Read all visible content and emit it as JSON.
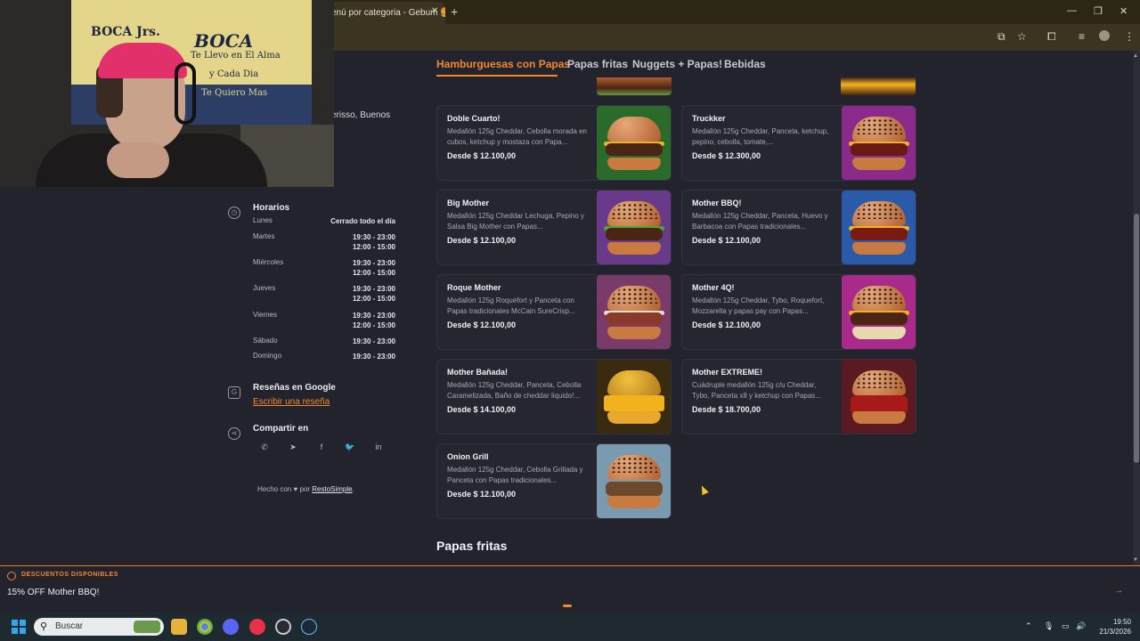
{
  "browser": {
    "tab_title": "enú por categoria - Gebum 🍔",
    "tab_close": "✕",
    "new_tab": "+",
    "window_controls": [
      "—",
      "❐",
      "✕"
    ]
  },
  "sidebar": {
    "address_fragment": "erisso, Buenos",
    "hours_heading": "Horarios",
    "hours": [
      {
        "day": "Lunes",
        "value": "Cerrado todo el día"
      },
      {
        "day": "Martes",
        "value": "19:30 - 23:00\n12:00 - 15:00"
      },
      {
        "day": "Miércoles",
        "value": "19:30 - 23:00\n12:00 - 15:00"
      },
      {
        "day": "Jueves",
        "value": "19:30 - 23:00\n12:00 - 15:00"
      },
      {
        "day": "Viernes",
        "value": "19:30 - 23:00\n12:00 - 15:00"
      },
      {
        "day": "Sábado",
        "value": "19:30 - 23:00"
      },
      {
        "day": "Domingo",
        "value": "19:30 - 23:00"
      }
    ],
    "reviews_heading": "Reseñas en Google",
    "reviews_link": "Escribir una reseña",
    "share_heading": "Compartir en",
    "share_icons": [
      "whatsapp-icon",
      "telegram-icon",
      "facebook-icon",
      "twitter-icon",
      "linkedin-icon"
    ],
    "footer_prefix": "Hecho con ♥ por",
    "footer_link": "RestoSimple",
    "footer_suffix": "."
  },
  "categories": [
    "Hamburguesas con Papas",
    "Papas fritas",
    "Nuggets + Papas!",
    "Bebidas"
  ],
  "products": [
    {
      "title": "Doble Cuarto!",
      "desc": "Medallón 125g Cheddar, Cebolla morada en cubos, ketchup y mostaza con Papa...",
      "price": "Desde $ 12.100,00"
    },
    {
      "title": "Truckker",
      "desc": "Medallón 125g Cheddar, Panceta, ketchup, pepino, cebolla, tomate,...",
      "price": "Desde $ 12.300,00"
    },
    {
      "title": "Big Mother",
      "desc": "Medallón 125g Cheddar Lechuga, Pepino y Salsa Big Mother con Papas...",
      "price": "Desde $ 12.100,00"
    },
    {
      "title": "Mother BBQ!",
      "desc": "Medallón 125g Cheddar, Panceta, Huevo y Barbacoa con Papas tradicionales...",
      "price": "Desde $ 12.100,00"
    },
    {
      "title": "Roque Mother",
      "desc": "Medallón 125g Roquefort y Panceta con Papas tradicionales McCain SureCrisp...",
      "price": "Desde $ 12.100,00"
    },
    {
      "title": "Mother 4Q!",
      "desc": "Medallón 125g Cheddar, Tybo, Roquefort, Mozzarella y papas pay con Papas...",
      "price": "Desde $ 12.100,00"
    },
    {
      "title": "Mother Bañada!",
      "desc": "Medallón 125g Cheddar, Panceta, Cebolla Caramelizada, Baño de cheddar liquido!...",
      "price": "Desde $ 14.100,00"
    },
    {
      "title": "Mother EXTREME!",
      "desc": "Cuádruple medallón 125g c/u Cheddar, Tybo, Panceta x8 y ketchup con Papas...",
      "price": "Desde $ 18.700,00"
    },
    {
      "title": "Onion Grill",
      "desc": "Medallón 125g Cheddar, Cebolla Grillada y Panceta con Papas tradicionales...",
      "price": "Desde $ 12.100,00"
    }
  ],
  "next_section_title": "Papas fritas",
  "discount": {
    "label": "DESCUENTOS DISPONIBLES",
    "offer": "15% OFF Mother BBQ!",
    "next_arrow": "→"
  },
  "webcam": {
    "flag_line1": "BOCA Jrs.",
    "flag_line2": "BOCA",
    "flag_line3": "Te Llevo en El Alma",
    "flag_line4": "y Cada Dia",
    "flag_line5": "Te Quiero Mas"
  },
  "taskbar": {
    "search_placeholder": "Buscar",
    "time": "19:50",
    "date": "21/3/2026"
  },
  "colors": {
    "accent": "#f08a2c",
    "page_bg": "#23232e",
    "card_bg": "#262631"
  }
}
